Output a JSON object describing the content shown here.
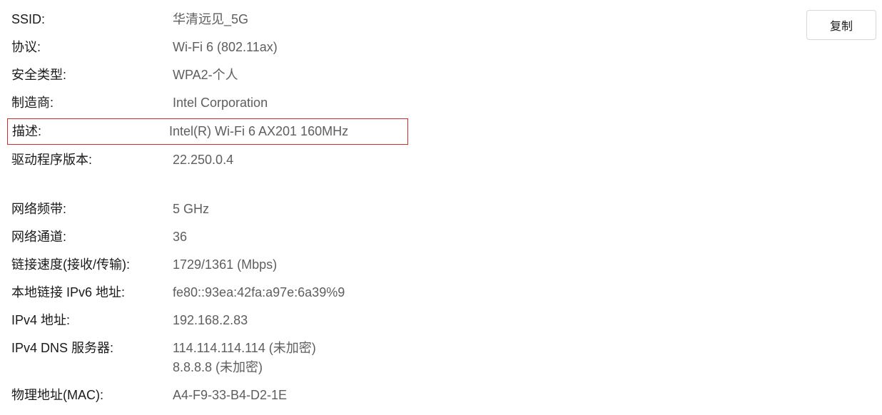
{
  "copy_button_label": "复制",
  "section1": {
    "ssid": {
      "label": "SSID:",
      "value": "华清远见_5G"
    },
    "protocol": {
      "label": "协议:",
      "value": "Wi-Fi 6 (802.11ax)"
    },
    "security_type": {
      "label": "安全类型:",
      "value": "WPA2-个人"
    },
    "manufacturer": {
      "label": "制造商:",
      "value": "Intel Corporation"
    },
    "description": {
      "label": "描述:",
      "value": "Intel(R) Wi-Fi 6 AX201 160MHz"
    },
    "driver_version": {
      "label": "驱动程序版本:",
      "value": "22.250.0.4"
    }
  },
  "section2": {
    "network_band": {
      "label": "网络频带:",
      "value": "5 GHz"
    },
    "network_channel": {
      "label": "网络通道:",
      "value": "36"
    },
    "link_speed": {
      "label": "链接速度(接收/传输):",
      "value": "1729/1361 (Mbps)"
    },
    "ipv6_local": {
      "label": "本地链接 IPv6 地址:",
      "value": "fe80::93ea:42fa:a97e:6a39%9"
    },
    "ipv4_addr": {
      "label": "IPv4 地址:",
      "value": "192.168.2.83"
    },
    "ipv4_dns": {
      "label": "IPv4 DNS 服务器:",
      "value1": "114.114.114.114 (未加密)",
      "value2": "8.8.8.8 (未加密)"
    },
    "mac": {
      "label": "物理地址(MAC):",
      "value": "A4-F9-33-B4-D2-1E"
    }
  },
  "highlighted_field": "description"
}
